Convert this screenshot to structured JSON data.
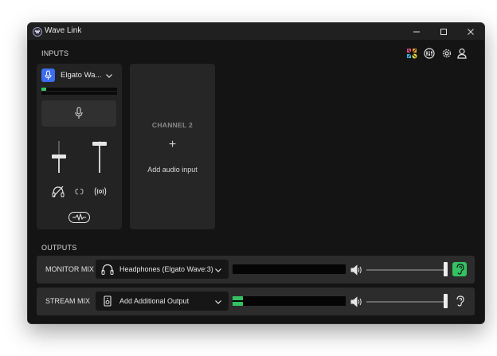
{
  "window": {
    "title": "Wave Link",
    "controls": {
      "minimize": "—",
      "maximize": "☐",
      "close": "✕"
    }
  },
  "sections": {
    "inputs": "INPUTS",
    "outputs": "OUTPUTS"
  },
  "toolbar_icons": [
    "marketplace-icon",
    "mixer-icon",
    "settings-icon",
    "account-icon"
  ],
  "inputs": [
    {
      "device_name": "Elgato Wa...",
      "meter_levels": [
        0.06,
        0.0
      ],
      "monitor_fader_level": 0.55,
      "stream_fader_level": 0.95,
      "icons": [
        "mic-mute-icon",
        "monitor-mute-icon",
        "link-icon",
        "stream-mute-icon",
        "effects-icon"
      ]
    }
  ],
  "add_channel": {
    "title": "CHANNEL 2",
    "plus": "+",
    "action": "Add audio input"
  },
  "outputs": [
    {
      "label": "MONITOR MIX",
      "device": "Headphones (Elgato Wave:3)",
      "device_icon": "headphones-icon",
      "meter_levels": [
        0.0,
        0.0
      ],
      "volume": 0.98,
      "listening": true
    },
    {
      "label": "STREAM MIX",
      "device": "Add Additional Output",
      "device_icon": "speaker-box-icon",
      "meter_levels": [
        0.09,
        0.09
      ],
      "volume": 0.98,
      "listening": false
    }
  ],
  "colors": {
    "accent_green": "#34c162",
    "mic_blue": "#3c6df0",
    "background": "#141414",
    "panel": "#232323"
  }
}
